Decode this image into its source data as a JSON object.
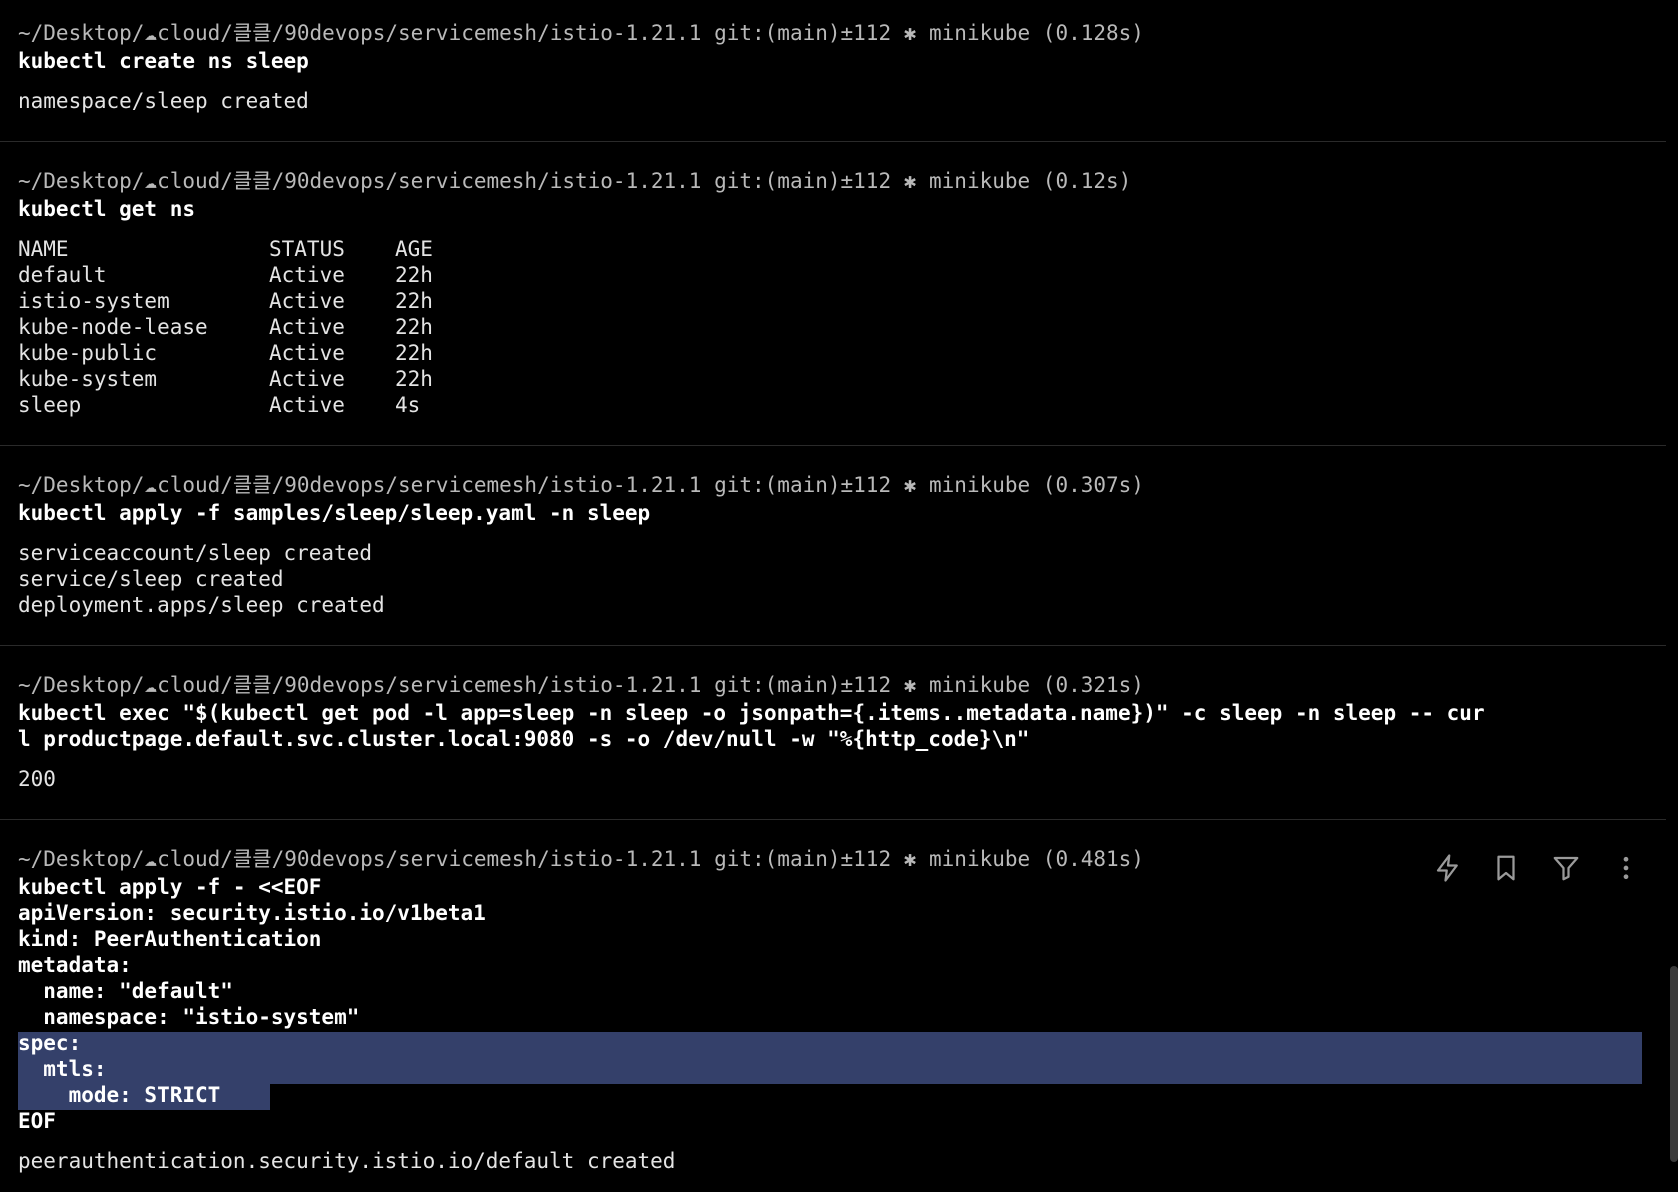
{
  "blocks": [
    {
      "prompt": "~/Desktop/☁cloud/클클/90devops/servicemesh/istio-1.21.1 git:(main)±112 ✱ minikube (0.128s)",
      "command": [
        "kubectl create ns sleep"
      ],
      "output": [
        "namespace/sleep created"
      ]
    },
    {
      "prompt": "~/Desktop/☁cloud/클클/90devops/servicemesh/istio-1.21.1 git:(main)±112 ✱ minikube (0.12s)",
      "command": [
        "kubectl get ns"
      ],
      "table": {
        "headers": [
          "NAME",
          "STATUS",
          "AGE"
        ],
        "rows": [
          [
            "default",
            "Active",
            "22h"
          ],
          [
            "istio-system",
            "Active",
            "22h"
          ],
          [
            "kube-node-lease",
            "Active",
            "22h"
          ],
          [
            "kube-public",
            "Active",
            "22h"
          ],
          [
            "kube-system",
            "Active",
            "22h"
          ],
          [
            "sleep",
            "Active",
            "4s"
          ]
        ]
      }
    },
    {
      "prompt": "~/Desktop/☁cloud/클클/90devops/servicemesh/istio-1.21.1 git:(main)±112 ✱ minikube (0.307s)",
      "command": [
        "kubectl apply -f samples/sleep/sleep.yaml -n sleep"
      ],
      "output": [
        "serviceaccount/sleep created",
        "service/sleep created",
        "deployment.apps/sleep created"
      ]
    },
    {
      "prompt": "~/Desktop/☁cloud/클클/90devops/servicemesh/istio-1.21.1 git:(main)±112 ✱ minikube (0.321s)",
      "command": [
        "kubectl exec \"$(kubectl get pod -l app=sleep -n sleep -o jsonpath={.items..metadata.name})\" -c sleep -n sleep -- cur",
        "l productpage.default.svc.cluster.local:9080 -s -o /dev/null -w \"%{http_code}\\n\""
      ],
      "output": [
        "200"
      ]
    },
    {
      "prompt": "~/Desktop/☁cloud/클클/90devops/servicemesh/istio-1.21.1 git:(main)±112 ✱ minikube (0.481s)",
      "command": [
        "kubectl apply -f - <<EOF",
        "apiVersion: security.istio.io/v1beta1",
        "kind: PeerAuthentication",
        "metadata:",
        "  name: \"default\"",
        "  namespace: \"istio-system\"",
        "spec:",
        "  mtls:",
        "    mode: STRICT",
        "EOF"
      ],
      "output": [
        "peerauthentication.security.istio.io/default created"
      ]
    }
  ],
  "toolbar": {
    "icons": [
      "lightning-icon",
      "bookmark-icon",
      "filter-icon",
      "more-vertical-icon"
    ]
  },
  "colors": {
    "background": "#000000",
    "prompt": "#b9b9b9",
    "command": "#ffffff",
    "selection": "#34406a",
    "divider": "#2a2a2a"
  }
}
